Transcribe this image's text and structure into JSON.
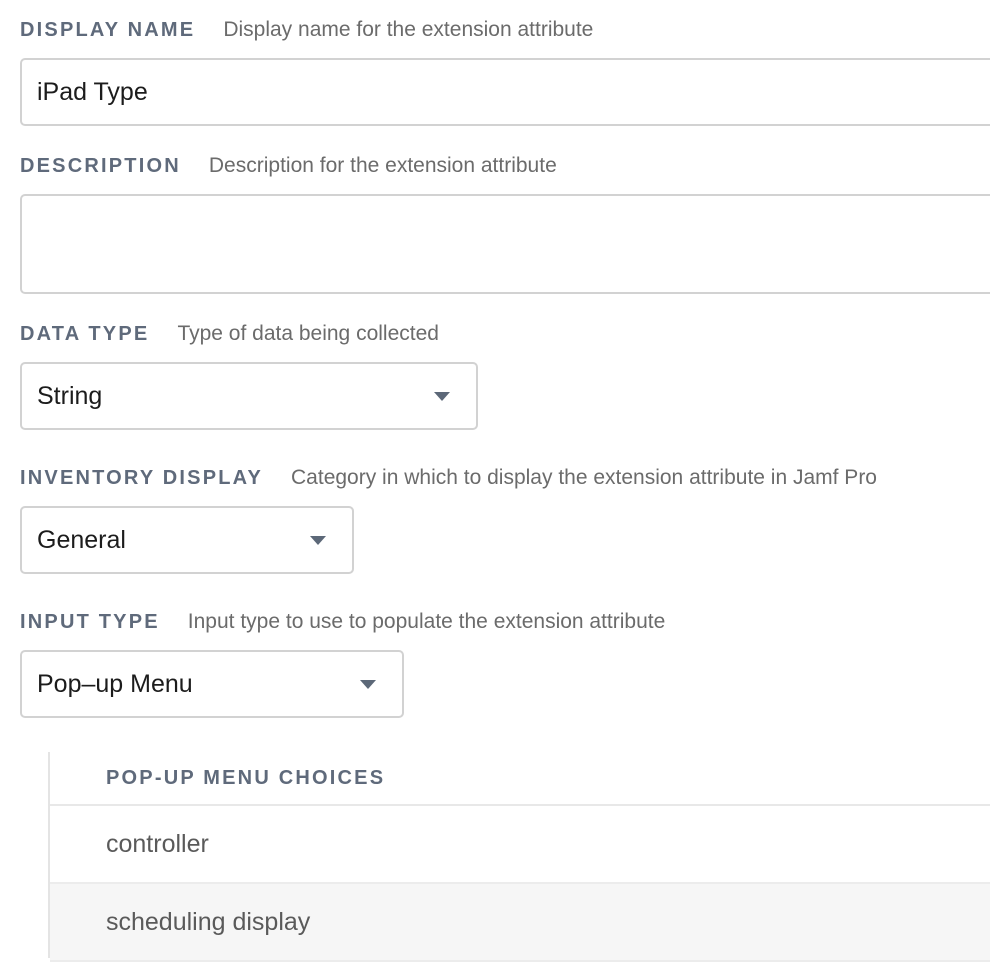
{
  "display_name": {
    "label": "DISPLAY NAME",
    "hint": "Display name for the extension attribute",
    "value": "iPad Type"
  },
  "description": {
    "label": "DESCRIPTION",
    "hint": "Description for the extension attribute",
    "value": ""
  },
  "data_type": {
    "label": "DATA TYPE",
    "hint": "Type of data being collected",
    "selected": "String",
    "icon": "chevron-down-icon"
  },
  "inventory_display": {
    "label": "INVENTORY DISPLAY",
    "hint": "Category in which to display the extension attribute in Jamf Pro",
    "selected": "General",
    "icon": "chevron-down-icon"
  },
  "input_type": {
    "label": "INPUT TYPE",
    "hint": "Input type to use to populate the extension attribute",
    "selected": "Pop–up Menu",
    "icon": "chevron-down-icon"
  },
  "popup_choices": {
    "header": "POP-UP MENU CHOICES",
    "items": [
      "controller",
      "scheduling display"
    ]
  },
  "colors": {
    "label": "#5f6a7b",
    "hint": "#6b6b6b",
    "border": "#d2d2d2",
    "caret": "#5c6878",
    "alt_row": "#f6f6f6"
  }
}
